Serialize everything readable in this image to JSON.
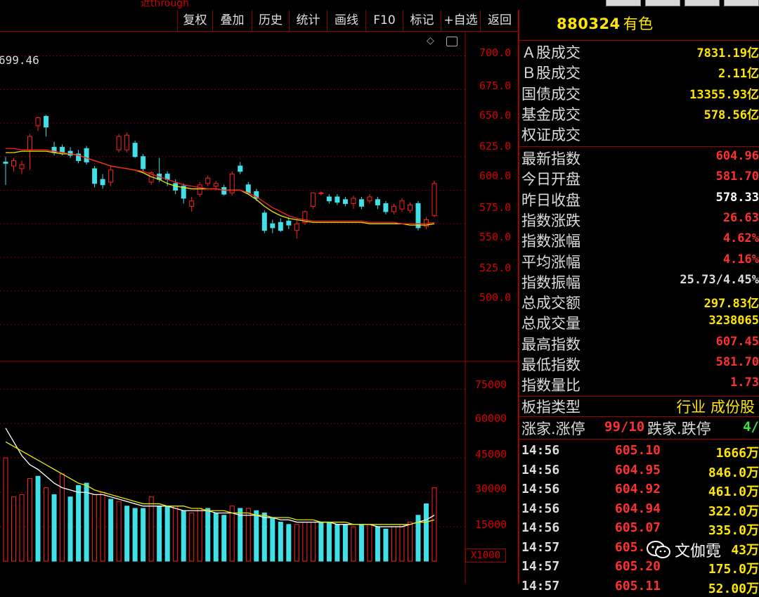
{
  "top": {
    "warning": "近through"
  },
  "toolbar": {
    "items": [
      "复权",
      "叠加",
      "历史",
      "统计",
      "画线",
      "F10",
      "标记",
      "+自选",
      "返回"
    ]
  },
  "symbol": {
    "code": "880324",
    "name": "有色"
  },
  "chart": {
    "partial_value": "699.46",
    "price_ticks": [
      "700.0",
      "675.0",
      "650.0",
      "625.0",
      "600.0",
      "575.0",
      "550.0",
      "525.0",
      "500.0"
    ],
    "volume_ticks": [
      "75000",
      "60000",
      "45000",
      "30000",
      "15000"
    ],
    "volume_unit": "X1000"
  },
  "chart_data": [
    {
      "type": "candlestick",
      "ylim": [
        485,
        705
      ],
      "grid": true,
      "series": [
        {
          "open": 621,
          "close": 620,
          "high": 625,
          "low": 604
        },
        {
          "open": 618,
          "close": 622,
          "high": 624,
          "low": 614
        },
        {
          "open": 616,
          "close": 619,
          "high": 622,
          "low": 612
        },
        {
          "open": 630,
          "close": 640,
          "high": 642,
          "low": 615
        },
        {
          "open": 648,
          "close": 654,
          "high": 655,
          "low": 644
        },
        {
          "open": 655,
          "close": 647,
          "high": 656,
          "low": 640
        },
        {
          "open": 632,
          "close": 628,
          "high": 636,
          "low": 626
        },
        {
          "open": 632,
          "close": 628,
          "high": 634,
          "low": 626
        },
        {
          "open": 629,
          "close": 626,
          "high": 632,
          "low": 624
        },
        {
          "open": 627,
          "close": 622,
          "high": 630,
          "low": 620
        },
        {
          "open": 631,
          "close": 621,
          "high": 633,
          "low": 619
        },
        {
          "open": 616,
          "close": 605,
          "high": 618,
          "low": 602
        },
        {
          "open": 608,
          "close": 604,
          "high": 612,
          "low": 601
        },
        {
          "open": 606,
          "close": 615,
          "high": 618,
          "low": 603
        },
        {
          "open": 630,
          "close": 640,
          "high": 642,
          "low": 628
        },
        {
          "open": 630,
          "close": 641,
          "high": 643,
          "low": 628
        },
        {
          "open": 635,
          "close": 625,
          "high": 637,
          "low": 624
        },
        {
          "open": 625,
          "close": 616,
          "high": 627,
          "low": 614
        },
        {
          "open": 606,
          "close": 613,
          "high": 614,
          "low": 604
        },
        {
          "open": 612,
          "close": 608,
          "high": 624,
          "low": 606
        },
        {
          "open": 612,
          "close": 608,
          "high": 614,
          "low": 603
        },
        {
          "open": 605,
          "close": 600,
          "high": 608,
          "low": 597
        },
        {
          "open": 603,
          "close": 594,
          "high": 605,
          "low": 590
        },
        {
          "open": 588,
          "close": 592,
          "high": 595,
          "low": 584
        },
        {
          "open": 597,
          "close": 604,
          "high": 606,
          "low": 595
        },
        {
          "open": 605,
          "close": 609,
          "high": 611,
          "low": 603
        },
        {
          "open": 603,
          "close": 605,
          "high": 607,
          "low": 600
        },
        {
          "open": 602,
          "close": 597,
          "high": 604,
          "low": 596
        },
        {
          "open": 598,
          "close": 612,
          "high": 614,
          "low": 596
        },
        {
          "open": 618,
          "close": 614,
          "high": 621,
          "low": 612
        },
        {
          "open": 604,
          "close": 598,
          "high": 606,
          "low": 597
        },
        {
          "open": 599,
          "close": 594,
          "high": 601,
          "low": 592
        },
        {
          "open": 583,
          "close": 570,
          "high": 585,
          "low": 568
        },
        {
          "open": 575,
          "close": 572,
          "high": 578,
          "low": 568
        },
        {
          "open": 576,
          "close": 570,
          "high": 579,
          "low": 569
        },
        {
          "open": 577,
          "close": 574,
          "high": 580,
          "low": 571
        },
        {
          "open": 570,
          "close": 575,
          "high": 578,
          "low": 564
        },
        {
          "open": 576,
          "close": 584,
          "high": 585,
          "low": 574
        },
        {
          "open": 588,
          "close": 598,
          "high": 598,
          "low": 586
        },
        {
          "open": 598,
          "close": 598,
          "high": 599,
          "low": 596
        },
        {
          "open": 595,
          "close": 592,
          "high": 597,
          "low": 590
        },
        {
          "open": 595,
          "close": 591,
          "high": 597,
          "low": 589
        },
        {
          "open": 593,
          "close": 590,
          "high": 595,
          "low": 588
        },
        {
          "open": 590,
          "close": 594,
          "high": 596,
          "low": 586
        },
        {
          "open": 593,
          "close": 588,
          "high": 595,
          "low": 586
        },
        {
          "open": 592,
          "close": 595,
          "high": 597,
          "low": 590
        },
        {
          "open": 593,
          "close": 589,
          "high": 595,
          "low": 586
        },
        {
          "open": 590,
          "close": 584,
          "high": 592,
          "low": 582
        },
        {
          "open": 584,
          "close": 588,
          "high": 590,
          "low": 582
        },
        {
          "open": 586,
          "close": 592,
          "high": 594,
          "low": 584
        },
        {
          "open": 585,
          "close": 589,
          "high": 591,
          "low": 583
        },
        {
          "open": 590,
          "close": 572,
          "high": 592,
          "low": 570
        },
        {
          "open": 573,
          "close": 578,
          "high": 580,
          "low": 571
        },
        {
          "open": 581,
          "close": 605,
          "high": 607,
          "low": 580
        }
      ],
      "ma_red": [
        631,
        631,
        630,
        630,
        630,
        630,
        629,
        628,
        627,
        626,
        624,
        622,
        620,
        618,
        617,
        616,
        615,
        614,
        612,
        610,
        608,
        606,
        604,
        603,
        602,
        601,
        601,
        600,
        600,
        600,
        598,
        595,
        591,
        587,
        584,
        581,
        579,
        578,
        577,
        577,
        577,
        577,
        577,
        577,
        577,
        576,
        576,
        576,
        576,
        575,
        575,
        575,
        575,
        576
      ],
      "ma_yellow": [
        628,
        628,
        629,
        629,
        629,
        629,
        628,
        627,
        627,
        626,
        624,
        622,
        620,
        618,
        617,
        616,
        615,
        613,
        610,
        608,
        605,
        603,
        602,
        601,
        601,
        601,
        601,
        600,
        600,
        600,
        597,
        593,
        588,
        584,
        581,
        579,
        578,
        577,
        576,
        576,
        576,
        576,
        576,
        576,
        576,
        575,
        575,
        575,
        575,
        575,
        574,
        574,
        574,
        575
      ]
    },
    {
      "type": "bar",
      "ylim": [
        0,
        80000
      ],
      "values": [
        45000,
        28000,
        29000,
        36000,
        37000,
        32000,
        29000,
        38000,
        28000,
        33000,
        34000,
        29000,
        30000,
        27000,
        26000,
        24000,
        23000,
        23000,
        28000,
        24000,
        24000,
        24000,
        22000,
        21000,
        23000,
        23000,
        21000,
        20000,
        24000,
        23000,
        23000,
        22000,
        21000,
        19000,
        17000,
        16000,
        16000,
        17000,
        17000,
        17000,
        17000,
        16000,
        16000,
        15000,
        16000,
        16000,
        15000,
        14000,
        15000,
        16000,
        17000,
        20000,
        25000,
        32000
      ],
      "up": [
        true,
        true,
        true,
        true,
        false,
        true,
        false,
        true,
        false,
        false,
        false,
        true,
        true,
        false,
        true,
        false,
        false,
        false,
        true,
        false,
        false,
        true,
        false,
        true,
        true,
        false,
        false,
        false,
        true,
        false,
        true,
        false,
        false,
        false,
        false,
        false,
        true,
        true,
        true,
        false,
        false,
        false,
        false,
        true,
        false,
        true,
        false,
        false,
        true,
        true,
        true,
        false,
        false,
        true
      ],
      "ma_white": [
        58000,
        52000,
        46000,
        42000,
        40000,
        37000,
        34000,
        32000,
        31000,
        30000,
        30000,
        29000,
        29000,
        28000,
        27000,
        26000,
        25000,
        24000,
        24000,
        24000,
        24000,
        23000,
        22000,
        22000,
        22000,
        22000,
        21000,
        21000,
        21000,
        20000,
        20000,
        20000,
        19000,
        19000,
        18000,
        18000,
        17000,
        17000,
        17000,
        17000,
        17000,
        16000,
        16000,
        16000,
        16000,
        16000,
        15000,
        15000,
        15000,
        15000,
        16000,
        17000,
        18000,
        20000
      ],
      "ma_yellow": [
        52000,
        50000,
        48000,
        46000,
        44000,
        42000,
        40000,
        38000,
        36000,
        34000,
        33000,
        31000,
        30000,
        29000,
        28000,
        27000,
        26000,
        25000,
        25000,
        25000,
        24000,
        24000,
        24000,
        23000,
        23000,
        22000,
        22000,
        22000,
        21000,
        21000,
        21000,
        20000,
        20000,
        19000,
        19000,
        19000,
        18000,
        18000,
        18000,
        17000,
        17000,
        17000,
        17000,
        16000,
        16000,
        16000,
        16000,
        16000,
        16000,
        16000,
        16000,
        17000,
        17000,
        18000
      ]
    }
  ],
  "panel": {
    "rows1": [
      {
        "label": "Ａ股成交",
        "value": "7831.19亿",
        "color": "#ffe600"
      },
      {
        "label": "Ｂ股成交",
        "value": "2.11亿",
        "color": "#ffe600"
      },
      {
        "label": "国债成交",
        "value": "13355.93亿",
        "color": "#ffe600"
      },
      {
        "label": "基金成交",
        "value": "578.56亿",
        "color": "#ffe600"
      },
      {
        "label": "权证成交",
        "value": "",
        "color": "#ffe600"
      }
    ],
    "rows2": [
      {
        "label": "最新指数",
        "value": "604.96",
        "color": "#ff3030"
      },
      {
        "label": "今日开盘",
        "value": "581.70",
        "color": "#ff3030"
      },
      {
        "label": "昨日收盘",
        "value": "578.33",
        "color": "#ffffff"
      },
      {
        "label": "指数涨跌",
        "value": "26.63",
        "color": "#ff3030"
      },
      {
        "label": "指数涨幅",
        "value": "4.62%",
        "color": "#ff3030"
      },
      {
        "label": "平均涨幅",
        "value": "4.16%",
        "color": "#ff3030"
      },
      {
        "label": "指数振幅",
        "value": "25.73/4.45%",
        "color": "#dcdcdc"
      },
      {
        "label": "总成交额",
        "value": "297.83亿",
        "color": "#ffe600"
      },
      {
        "label": "总成交量",
        "value": "3238065",
        "color": "#ffe600"
      },
      {
        "label": "最高指数",
        "value": "607.45",
        "color": "#ff3030"
      },
      {
        "label": "最低指数",
        "value": "581.70",
        "color": "#ff3030"
      },
      {
        "label": "指数量比",
        "value": "1.73",
        "color": "#ff3030"
      }
    ],
    "type_label": "板指类型",
    "type_value": "行业 成份股",
    "up_label": "涨家.涨停",
    "up_value": "99/10",
    "down_label": "跌家.跌停",
    "down_value": "4/",
    "ticks": [
      {
        "time": "14:56",
        "price": "605.10",
        "vol": "1666万"
      },
      {
        "time": "14:56",
        "price": "604.95",
        "vol": "846.0万"
      },
      {
        "time": "14:56",
        "price": "604.92",
        "vol": "461.0万"
      },
      {
        "time": "14:56",
        "price": "604.94",
        "vol": "322.0万"
      },
      {
        "time": "14:56",
        "price": "605.07",
        "vol": "335.0万"
      },
      {
        "time": "14:57",
        "price": "605.",
        "vol": "43万"
      },
      {
        "time": "14:57",
        "price": "605.20",
        "vol": "175.0万"
      },
      {
        "time": "14:57",
        "price": "605.11",
        "vol": "52.00万"
      }
    ]
  },
  "watermark": {
    "text": "文伽霓"
  },
  "colors": {
    "up": "#ff2020",
    "down": "#40e0e8",
    "ma_yellow": "#e8e800",
    "ma_white": "#ffffff",
    "grid": "#7a0000",
    "accent": "#a00000"
  }
}
